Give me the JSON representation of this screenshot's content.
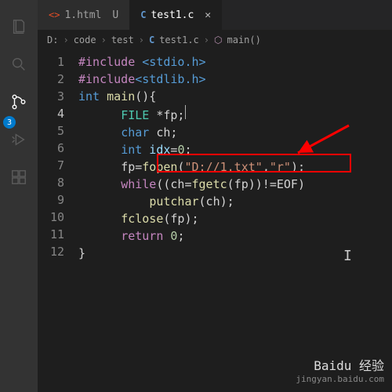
{
  "activity": {
    "badge": "3"
  },
  "tabs": [
    {
      "label": "1.html",
      "modified": "U"
    },
    {
      "label": "test1.c"
    }
  ],
  "breadcrumb": {
    "p0": "D:",
    "p1": "code",
    "p2": "test",
    "p3": "test1.c",
    "p4": "main()"
  },
  "lines": [
    "1",
    "2",
    "3",
    "4",
    "5",
    "6",
    "7",
    "8",
    "9",
    "10",
    "11",
    "12"
  ],
  "activeLine": "4",
  "code": {
    "l1_hash": "#include",
    "l1_inc": " <stdio.h>",
    "l2_hash": "#include",
    "l2_inc": "<stdlib.h>",
    "l3_int": "int",
    "l3_main": " main",
    "l3_paren": "(){",
    "l4_pad": "      ",
    "l4_type": "FILE",
    "l4_rest": " *fp;",
    "l5_pad": "      ",
    "l5_type": "char",
    "l5_rest": " ch;",
    "l6_pad": "      ",
    "l6_type": "int",
    "l6_var": " idx",
    "l6_eq": "=",
    "l6_num": "0",
    "l6_semi": ";",
    "l7_pad": "      ",
    "l7_a": "fp=",
    "l7_fn": "fopen",
    "l7_p1": "(",
    "l7_s1": "\"D://1.txt\"",
    "l7_c": ",",
    "l7_s2": "\"r\"",
    "l7_p2": ");",
    "l8_pad": "      ",
    "l8_kw": "while",
    "l8_a": "((ch=",
    "l8_fn": "fgetc",
    "l8_b": "(fp))!=EOF)",
    "l9_pad": "          ",
    "l9_fn": "putchar",
    "l9_a": "(ch);",
    "l10_pad": "      ",
    "l10_fn": "fclose",
    "l10_a": "(fp);",
    "l11_pad": "      ",
    "l11_kw": "return",
    "l11_sp": " ",
    "l11_num": "0",
    "l11_semi": ";",
    "l12": "}"
  },
  "watermark": {
    "brand": "Baidu 经验",
    "url": "jingyan.baidu.com"
  }
}
